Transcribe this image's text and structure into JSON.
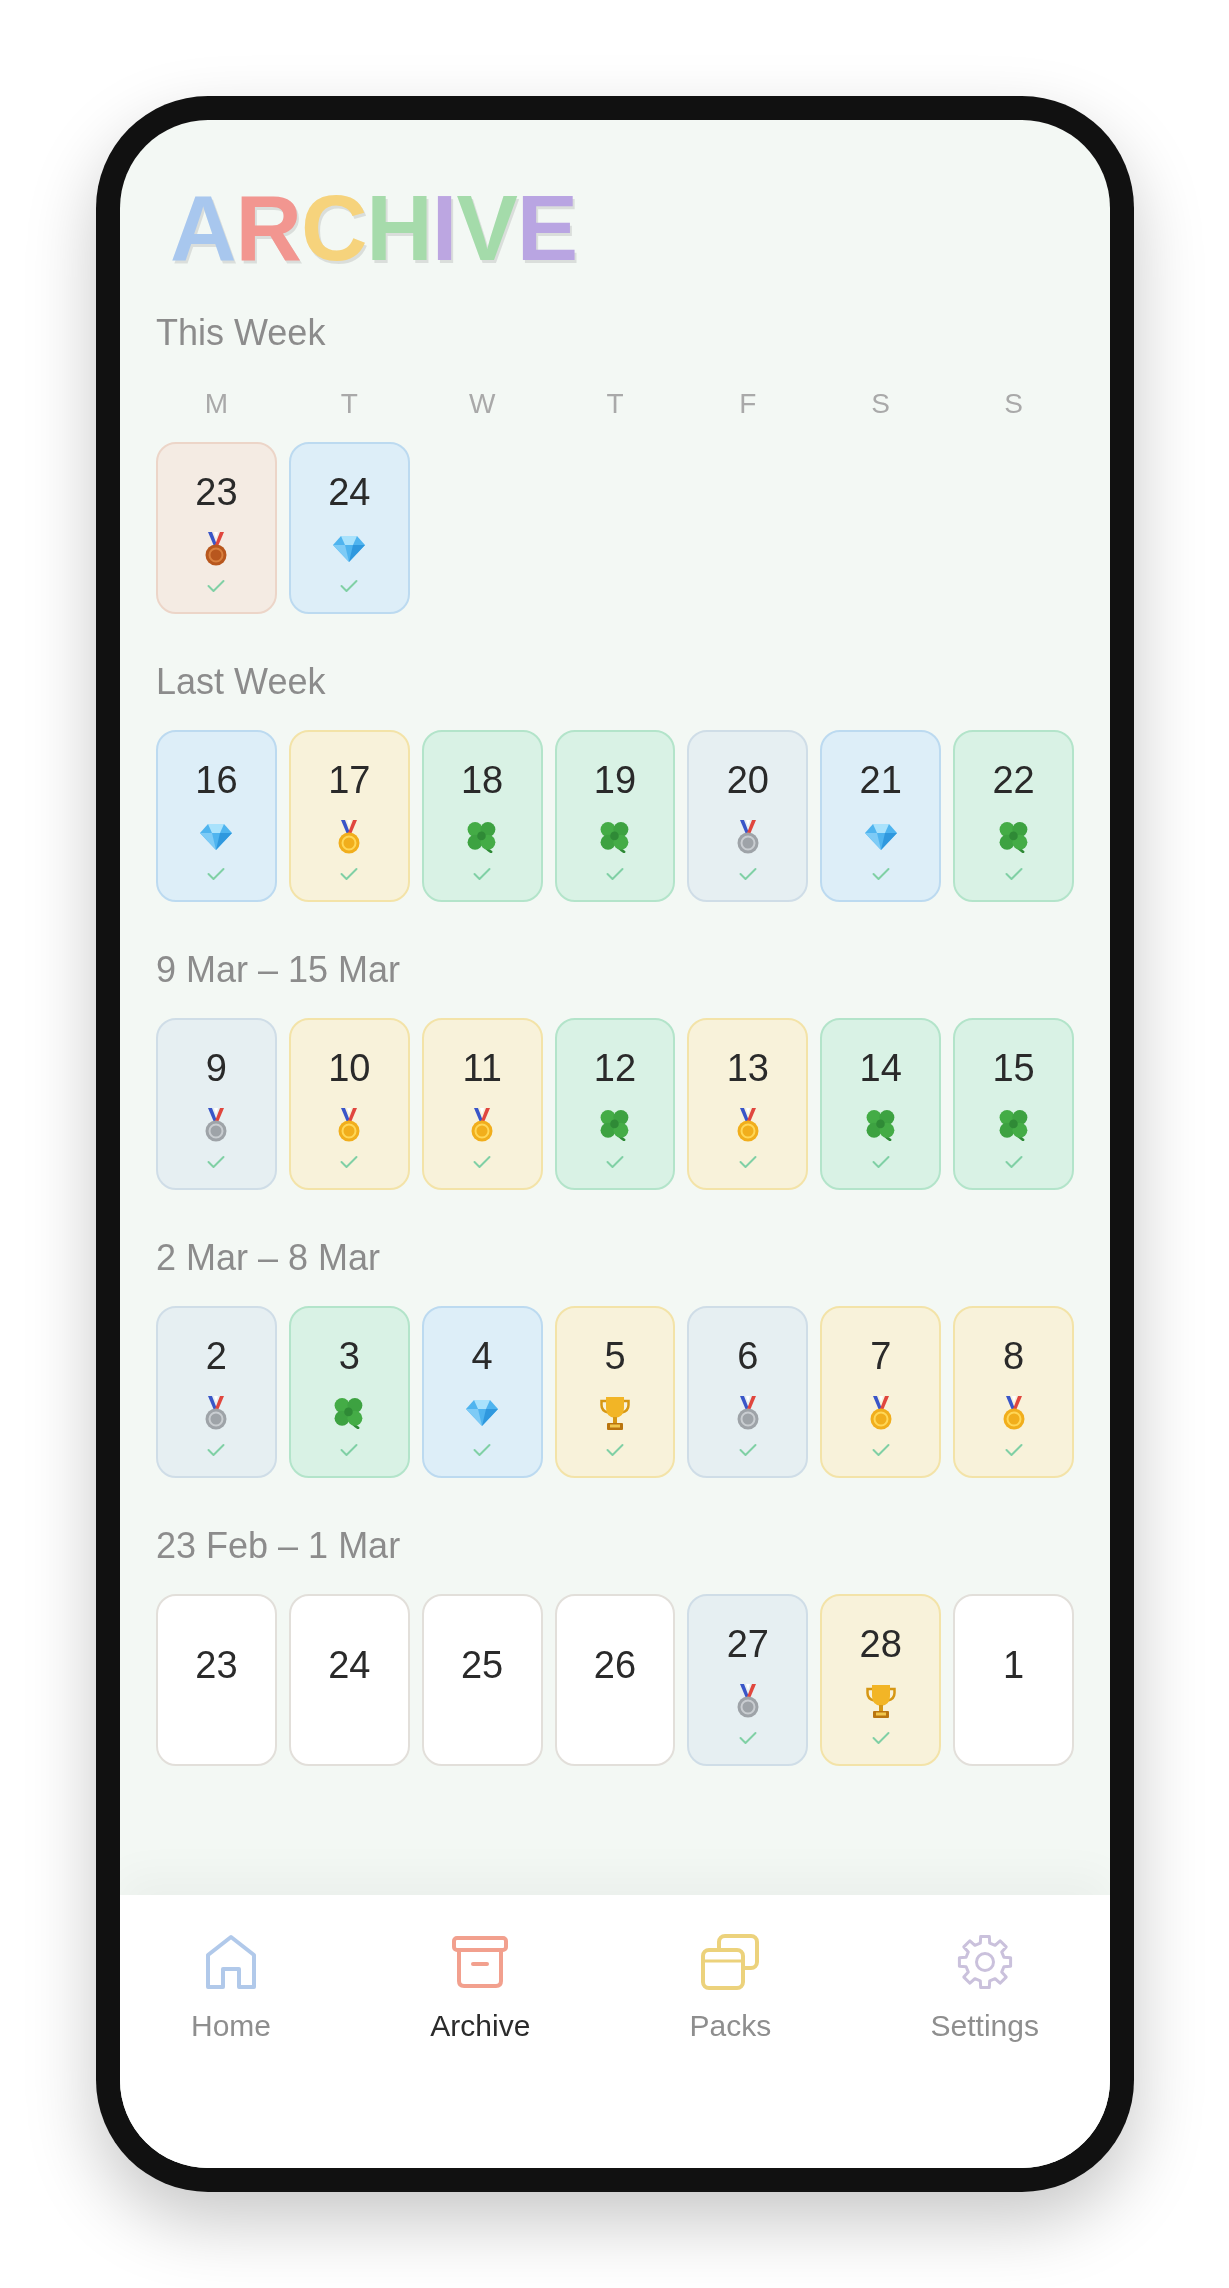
{
  "title": "ARCHIVE",
  "weeks": [
    {
      "label": "This Week",
      "weekdays": [
        "M",
        "T",
        "W",
        "T",
        "F",
        "S",
        "S"
      ],
      "days": [
        {
          "date": "23",
          "kind": "bronze",
          "completed": true
        },
        {
          "date": "24",
          "kind": "gem",
          "completed": true
        }
      ]
    },
    {
      "label": "Last Week",
      "days": [
        {
          "date": "16",
          "kind": "gem",
          "completed": true
        },
        {
          "date": "17",
          "kind": "gold",
          "completed": true
        },
        {
          "date": "18",
          "kind": "clover",
          "completed": true
        },
        {
          "date": "19",
          "kind": "clover",
          "completed": true
        },
        {
          "date": "20",
          "kind": "silver",
          "completed": true
        },
        {
          "date": "21",
          "kind": "gem",
          "completed": true
        },
        {
          "date": "22",
          "kind": "clover",
          "completed": true
        }
      ]
    },
    {
      "label": "9 Mar – 15 Mar",
      "days": [
        {
          "date": "9",
          "kind": "silver",
          "completed": true
        },
        {
          "date": "10",
          "kind": "gold",
          "completed": true
        },
        {
          "date": "11",
          "kind": "gold",
          "completed": true
        },
        {
          "date": "12",
          "kind": "clover",
          "completed": true
        },
        {
          "date": "13",
          "kind": "gold",
          "completed": true
        },
        {
          "date": "14",
          "kind": "clover",
          "completed": true
        },
        {
          "date": "15",
          "kind": "clover",
          "completed": true
        }
      ]
    },
    {
      "label": "2 Mar – 8 Mar",
      "days": [
        {
          "date": "2",
          "kind": "silver",
          "completed": true
        },
        {
          "date": "3",
          "kind": "clover",
          "completed": true
        },
        {
          "date": "4",
          "kind": "gem",
          "completed": true
        },
        {
          "date": "5",
          "kind": "trophy",
          "completed": true
        },
        {
          "date": "6",
          "kind": "silver",
          "completed": true
        },
        {
          "date": "7",
          "kind": "gold",
          "completed": true
        },
        {
          "date": "8",
          "kind": "gold",
          "completed": true
        }
      ]
    },
    {
      "label": "23 Feb – 1 Mar",
      "days": [
        {
          "date": "23",
          "kind": "empty",
          "completed": false
        },
        {
          "date": "24",
          "kind": "empty",
          "completed": false
        },
        {
          "date": "25",
          "kind": "empty",
          "completed": false
        },
        {
          "date": "26",
          "kind": "empty",
          "completed": false
        },
        {
          "date": "27",
          "kind": "silver",
          "completed": true
        },
        {
          "date": "28",
          "kind": "trophy",
          "completed": true
        },
        {
          "date": "1",
          "kind": "empty",
          "completed": false
        }
      ]
    }
  ],
  "nav": [
    {
      "label": "Home",
      "selected": false
    },
    {
      "label": "Archive",
      "selected": true
    },
    {
      "label": "Packs",
      "selected": false
    },
    {
      "label": "Settings",
      "selected": false
    }
  ]
}
